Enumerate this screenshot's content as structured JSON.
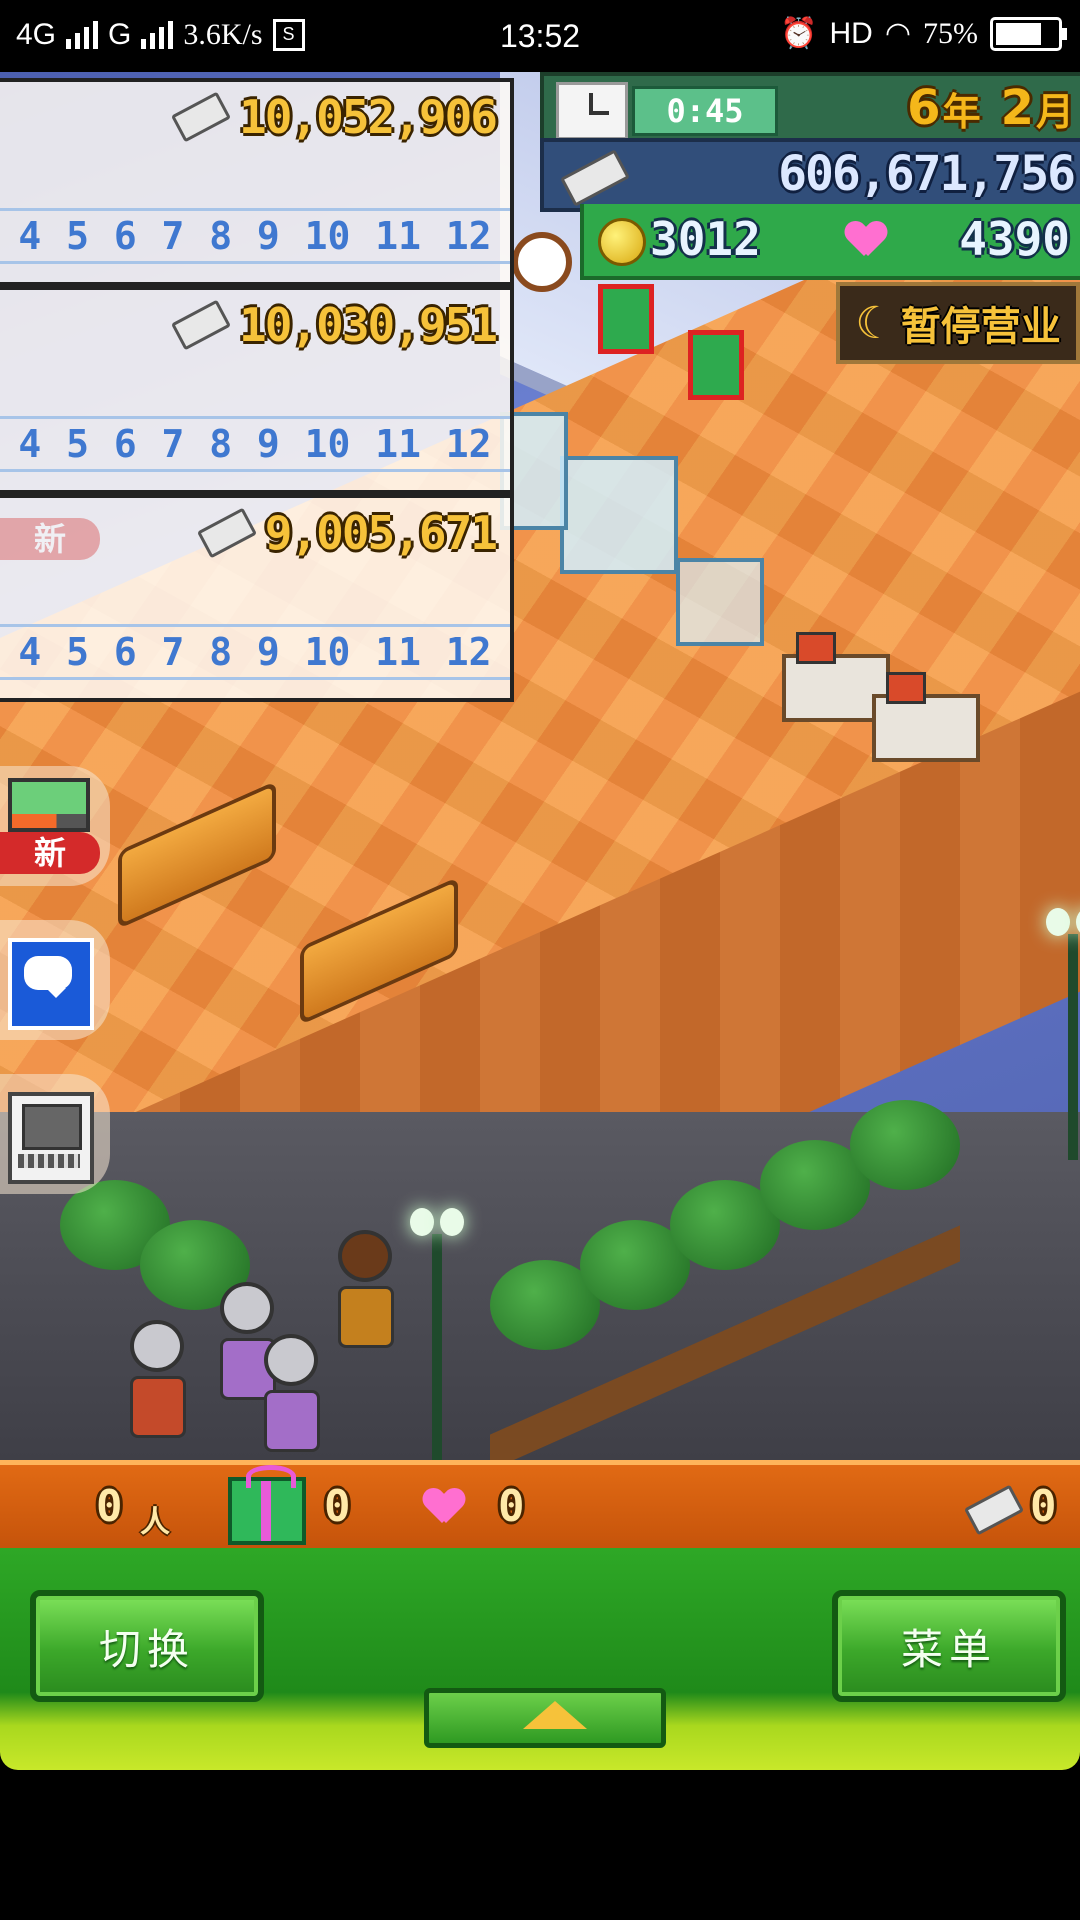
{
  "status_bar": {
    "network_1": "4G",
    "network_2": "G",
    "speed": "3.6K/s",
    "time": "13:52",
    "hd": "HD",
    "battery": "75%",
    "battery_level": 0.75
  },
  "hud": {
    "timer": "0:45",
    "year_num": "6",
    "year_unit": "年",
    "month_num": "2",
    "month_unit": "月",
    "money": "606,671,756",
    "coins": "3012",
    "hearts": "4390",
    "closed_label": "暂停营业"
  },
  "rank_panels": [
    {
      "value": "10,052,906",
      "months": [
        "4",
        "5",
        "6",
        "7",
        "8",
        "9",
        "10",
        "11",
        "12"
      ]
    },
    {
      "value": "10,030,951",
      "months": [
        "4",
        "5",
        "6",
        "7",
        "8",
        "9",
        "10",
        "11",
        "12"
      ]
    },
    {
      "value": "9,005,671",
      "months": [
        "4",
        "5",
        "6",
        "7",
        "8",
        "9",
        "10",
        "11",
        "12"
      ]
    }
  ],
  "side_buttons": {
    "new_label": "新",
    "new_label_faded": "新"
  },
  "stats_bar": {
    "visitors": "0",
    "visitors_unit": "人",
    "gifts": "0",
    "hearts": "0",
    "tickets": "0"
  },
  "bottom": {
    "switch_label": "切换",
    "menu_label": "菜单"
  },
  "colors": {
    "accent_green": "#2ea826",
    "stats_orange": "#e16a14",
    "gold": "#f6c23a"
  }
}
